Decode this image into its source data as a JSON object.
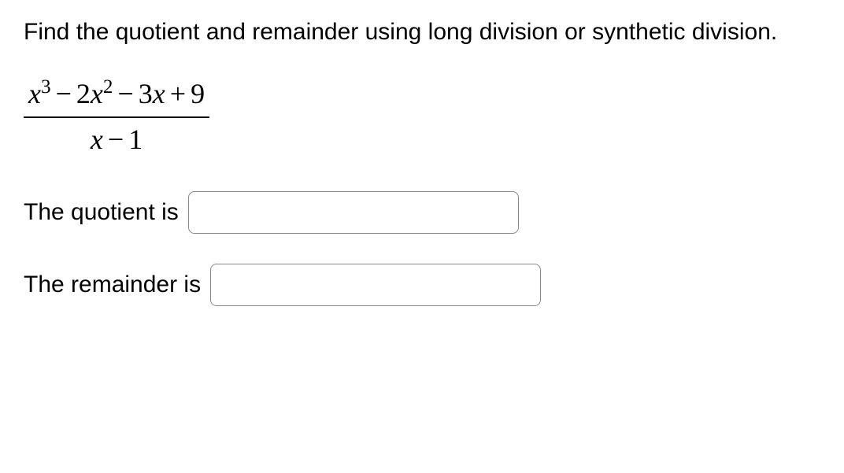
{
  "instruction": "Find the quotient and remainder using long division or synthetic division.",
  "expression": {
    "numerator_display": "x³ − 2x² − 3x + 9",
    "denominator_display": "x − 1",
    "numerator_terms": [
      "x",
      "3",
      "2",
      "x",
      "2",
      "3",
      "x",
      "9"
    ],
    "denominator_terms": [
      "x",
      "1"
    ]
  },
  "labels": {
    "quotient": "The quotient is",
    "remainder": "The remainder is"
  },
  "inputs": {
    "quotient_value": "",
    "remainder_value": ""
  }
}
